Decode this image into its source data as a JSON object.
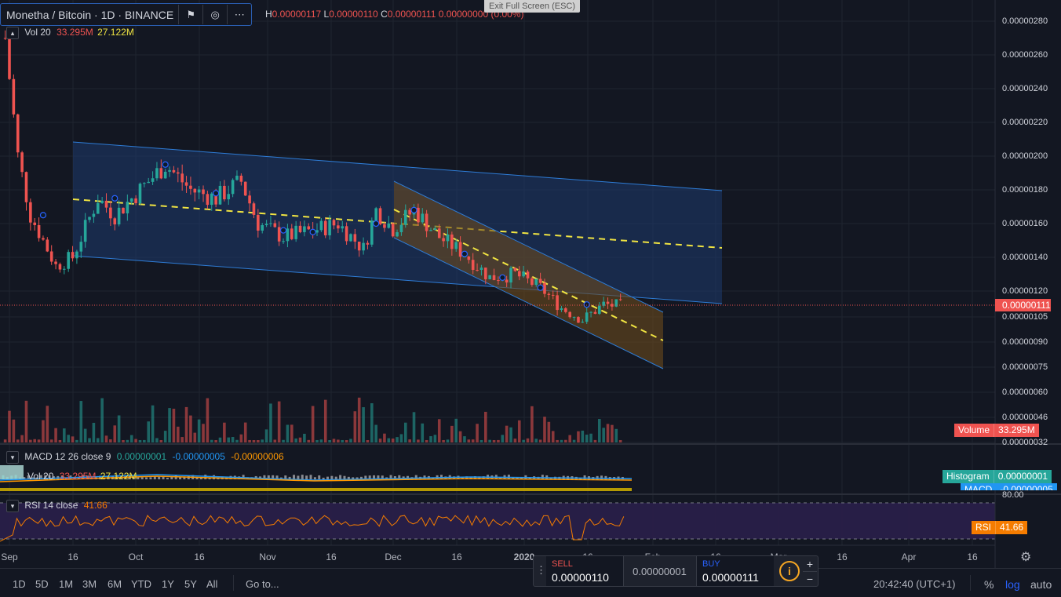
{
  "header": {
    "symbol_title": "Monetha / Bitcoin · 1D · BINANCE",
    "ohlc": {
      "h_label": "H",
      "h": "0.00000117",
      "l_label": "L",
      "l": "0.00000110",
      "c_label": "C",
      "c": "0.00000111",
      "chg": "0.00000000 (0.00%)"
    },
    "exit_fullscreen": "Exit Full Screen (ESC)"
  },
  "volume_legend": {
    "label": "Vol 20",
    "v1": "33.295M",
    "v2": "27.122M"
  },
  "macd_legend": {
    "label": "MACD 12 26 close 9",
    "v1": "0.00000001",
    "v2": "-0.00000005",
    "v3": "-0.00000006"
  },
  "vol2_legend": {
    "label": "Vol 20",
    "v1": "33.295M",
    "v2": "27.122M"
  },
  "rsi_legend": {
    "label": "RSI 14 close",
    "v1": "41.66"
  },
  "price_axis": {
    "ticks": [
      "0.00000280",
      "0.00000260",
      "0.00000240",
      "0.00000220",
      "0.00000200",
      "0.00000180",
      "0.00000160",
      "0.00000140",
      "0.00000120",
      "0.00000105",
      "0.00000090",
      "0.00000075",
      "0.00000060",
      "0.00000046",
      "0.00000032"
    ],
    "current_price": "0.00000111",
    "volume_tag_label": "Volume",
    "volume_tag_value": "33.295M",
    "histogram_label": "Histogram",
    "histogram_value": "0.00000001",
    "macd_label": "MACD",
    "macd_value": "-0.00000005",
    "rsi_level": "80.00",
    "rsi_label": "RSI",
    "rsi_value": "41.66"
  },
  "time_axis": {
    "ticks": [
      "Sep",
      "16",
      "Oct",
      "16",
      "Nov",
      "16",
      "Dec",
      "16",
      "2020",
      "16",
      "Feb",
      "16",
      "Mar",
      "16",
      "Apr",
      "16"
    ]
  },
  "bottom_bar": {
    "ranges": [
      "1D",
      "5D",
      "1M",
      "3M",
      "6M",
      "YTD",
      "1Y",
      "5Y",
      "All"
    ],
    "goto": "Go to...",
    "clock": "20:42:40 (UTC+1)",
    "percent": "%",
    "log": "log",
    "auto": "auto"
  },
  "trade": {
    "sell_label": "SELL",
    "sell_value": "0.00000110",
    "spread": "0.00000001",
    "buy_label": "BUY",
    "buy_value": "0.00000111",
    "info": "i",
    "plus": "+",
    "minus": "−"
  },
  "colors": {
    "bg": "#131722",
    "up": "#26a69a",
    "down": "#ef5350",
    "channel_fill": "#1e3a6e",
    "channel_line": "#2e7cd6",
    "desc_channel_fill": "#6b4a1d",
    "midline": "#f0e442",
    "rsi_line": "#f57c00",
    "rsi_band": "#2a1f4a",
    "accent": "#2962ff"
  },
  "chart_data": {
    "type": "candlestick",
    "symbol": "Monetha / Bitcoin",
    "interval": "1D",
    "exchange": "BINANCE",
    "ylim": [
      3.2e-07,
      2.9e-06
    ],
    "last_price": 1.11e-06,
    "close_path": [
      {
        "x": "Aug 31",
        "y": 2.7e-06
      },
      {
        "x": "Sep 3",
        "y": 2e-06
      },
      {
        "x": "Sep 6",
        "y": 1.65e-06
      },
      {
        "x": "Sep 9",
        "y": 1.5e-06
      },
      {
        "x": "Sep 12",
        "y": 1.35e-06
      },
      {
        "x": "Sep 16",
        "y": 1.4e-06
      },
      {
        "x": "Sep 22",
        "y": 1.75e-06
      },
      {
        "x": "Sep 26",
        "y": 1.65e-06
      },
      {
        "x": "Oct 2",
        "y": 1.8e-06
      },
      {
        "x": "Oct 8",
        "y": 1.95e-06
      },
      {
        "x": "Oct 14",
        "y": 1.8e-06
      },
      {
        "x": "Oct 20",
        "y": 1.75e-06
      },
      {
        "x": "Oct 26",
        "y": 1.85e-06
      },
      {
        "x": "Oct 30",
        "y": 1.6e-06
      },
      {
        "x": "Nov 5",
        "y": 1.52e-06
      },
      {
        "x": "Nov 12",
        "y": 1.56e-06
      },
      {
        "x": "Nov 18",
        "y": 1.6e-06
      },
      {
        "x": "Nov 24",
        "y": 1.45e-06
      },
      {
        "x": "Nov 27",
        "y": 1.68e-06
      },
      {
        "x": "Dec 1",
        "y": 1.57e-06
      },
      {
        "x": "Dec 6",
        "y": 1.68e-06
      },
      {
        "x": "Dec 12",
        "y": 1.52e-06
      },
      {
        "x": "Dec 18",
        "y": 1.42e-06
      },
      {
        "x": "Dec 24",
        "y": 1.28e-06
      },
      {
        "x": "Dec 30",
        "y": 1.3e-06
      },
      {
        "x": "Jan 5",
        "y": 1.22e-06
      },
      {
        "x": "Jan 10",
        "y": 1.1e-06
      },
      {
        "x": "Jan 15",
        "y": 1.03e-06
      },
      {
        "x": "Jan 20",
        "y": 1.12e-06
      },
      {
        "x": "Jan 25",
        "y": 1.11e-06
      }
    ],
    "volume_range": [
      0,
      4.5
    ],
    "rsi": {
      "value": 41.66,
      "upper": 80,
      "lower": 20
    }
  }
}
